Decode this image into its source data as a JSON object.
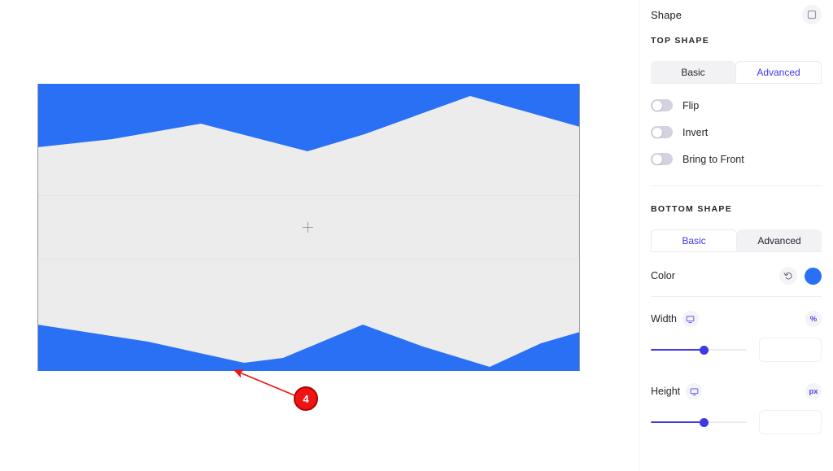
{
  "canvas": {
    "preview": {
      "background_color": "#ECECEC",
      "shape_color": "#2970F5",
      "crosshair_icon": "plus-icon"
    },
    "annotation": {
      "step_number": "4",
      "marker_color": "#EE1414"
    }
  },
  "panel": {
    "header": {
      "title": "Shape",
      "icon": "shape-square-icon"
    },
    "top_shape": {
      "section_label": "TOP SHAPE",
      "tabs": [
        {
          "label": "Basic",
          "active": false
        },
        {
          "label": "Advanced",
          "active": true
        }
      ],
      "toggles": [
        {
          "label": "Flip",
          "on": false
        },
        {
          "label": "Invert",
          "on": false
        },
        {
          "label": "Bring to Front",
          "on": false
        }
      ]
    },
    "bottom_shape": {
      "section_label": "BOTTOM SHAPE",
      "tabs": [
        {
          "label": "Basic",
          "active": true
        },
        {
          "label": "Advanced",
          "active": false
        }
      ],
      "color": {
        "label": "Color",
        "reset_icon": "reset-undo-icon",
        "swatch_color": "#2970F5"
      },
      "width": {
        "label": "Width",
        "responsive_icon": "desktop-monitor-icon",
        "unit": "%",
        "value": "",
        "slider_percent": 55
      },
      "height": {
        "label": "Height",
        "responsive_icon": "desktop-monitor-icon",
        "unit": "px",
        "value": "",
        "slider_percent": 55
      }
    },
    "accent_color": "#3D38E8"
  }
}
